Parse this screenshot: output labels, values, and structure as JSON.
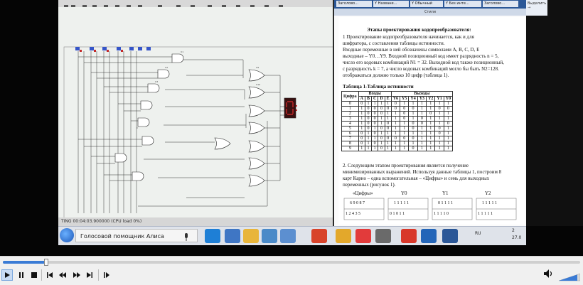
{
  "proteus": {
    "status_text": "TING  00:04:03.900000 (CPU load 0%)"
  },
  "word": {
    "tabs": [
      "Заголово...",
      "Y Названи...",
      "Y Обычный",
      "Y Без инте...",
      "Заголово..."
    ],
    "ribbon_group": "Стили",
    "side_label": "Выделить →",
    "doc": {
      "heading": "Этапы проектирования кодопреобразователя:",
      "p1": [
        "1    Проектирование кодопреобразователя начинается, как и для",
        "шифратора, с составления таблицы истинности.",
        "Входные переменные в ней обозначены символами A, B, C, D, E",
        "выходные – Y0…Y9. Входной позиционный код имеет разрядность n = 5,",
        "число его кодовых комбинаций N1 = 32. Выходной код также позиционный,",
        "с разрядность k = 7, а число кодовых комбинаций могло бы быть N2=128.",
        "отображаться должно только  10 цифр (таблица 1)."
      ],
      "table_caption": "Таблица 1-Таблица истинности",
      "table_headers": [
        "Цифра",
        "Входы",
        "Выходы"
      ],
      "table_subheaders": [
        "A",
        "B",
        "C",
        "D",
        "E",
        "Y6",
        "Y5",
        "Y4",
        "Y3",
        "Y2",
        "Y1",
        "Y0"
      ],
      "table_rows": [
        [
          "0",
          "0",
          "1",
          "1",
          "1",
          "1",
          "0",
          "1",
          "1",
          "1",
          "1",
          "1",
          "1"
        ],
        [
          "1",
          "1",
          "0",
          "0",
          "0",
          "0",
          "0",
          "0",
          "0",
          "1",
          "1",
          "0",
          "0"
        ],
        [
          "2",
          "1",
          "0",
          "0",
          "0",
          "1",
          "1",
          "0",
          "1",
          "1",
          "0",
          "1",
          "1"
        ],
        [
          "3",
          "1",
          "0",
          "0",
          "1",
          "1",
          "1",
          "0",
          "1",
          "0",
          "1",
          "1",
          "1"
        ],
        [
          "4",
          "1",
          "0",
          "0",
          "1",
          "0",
          "1",
          "1",
          "0",
          "0",
          "1",
          "1",
          "0"
        ],
        [
          "5",
          "1",
          "0",
          "1",
          "0",
          "0",
          "1",
          "1",
          "0",
          "1",
          "1",
          "0",
          "1"
        ],
        [
          "6",
          "0",
          "1",
          "0",
          "1",
          "1",
          "1",
          "1",
          "1",
          "1",
          "1",
          "0",
          "1"
        ],
        [
          "7",
          "0",
          "1",
          "1",
          "0",
          "0",
          "0",
          "0",
          "0",
          "1",
          "1",
          "1",
          "1"
        ],
        [
          "8",
          "0",
          "1",
          "0",
          "1",
          "1",
          "1",
          "1",
          "1",
          "1",
          "1",
          "1",
          "1"
        ],
        [
          "9",
          "1",
          "1",
          "1",
          "0",
          "1",
          "1",
          "1",
          "0",
          "1",
          "1",
          "1",
          "1"
        ]
      ],
      "p2": [
        "2. Следующим этапом проектирования является получение",
        "минимизированных выражений. Используя данные таблицы 1, построим 8",
        "карт Карно – одна вспомогательная – «Цифры» и семь для выходных",
        "переменных (рисунок 1)."
      ],
      "karnaugh_labels": [
        "«Цифры»",
        "Y0",
        "Y1",
        "Y2"
      ],
      "karnaugh_row1": [
        "6  9 0 8 7",
        "1  1 1 1 1",
        "0  1 1 1 1",
        "1  1 1 1 1"
      ],
      "karnaugh_row2": [
        "1 2 4 3     5",
        "0 1 0 1     1",
        "1 1 1 1     0",
        "1 1 1 1     1"
      ]
    }
  },
  "taskbar": {
    "search_text": "Голосовой помощник Алиса",
    "tray_lang": "RU",
    "tray_time": "2",
    "tray_date": "27.0"
  },
  "player": {
    "progress": 0.075,
    "buttons": [
      "play",
      "pause",
      "stop",
      "previous",
      "rewind",
      "forward",
      "next",
      "frame-step"
    ]
  }
}
